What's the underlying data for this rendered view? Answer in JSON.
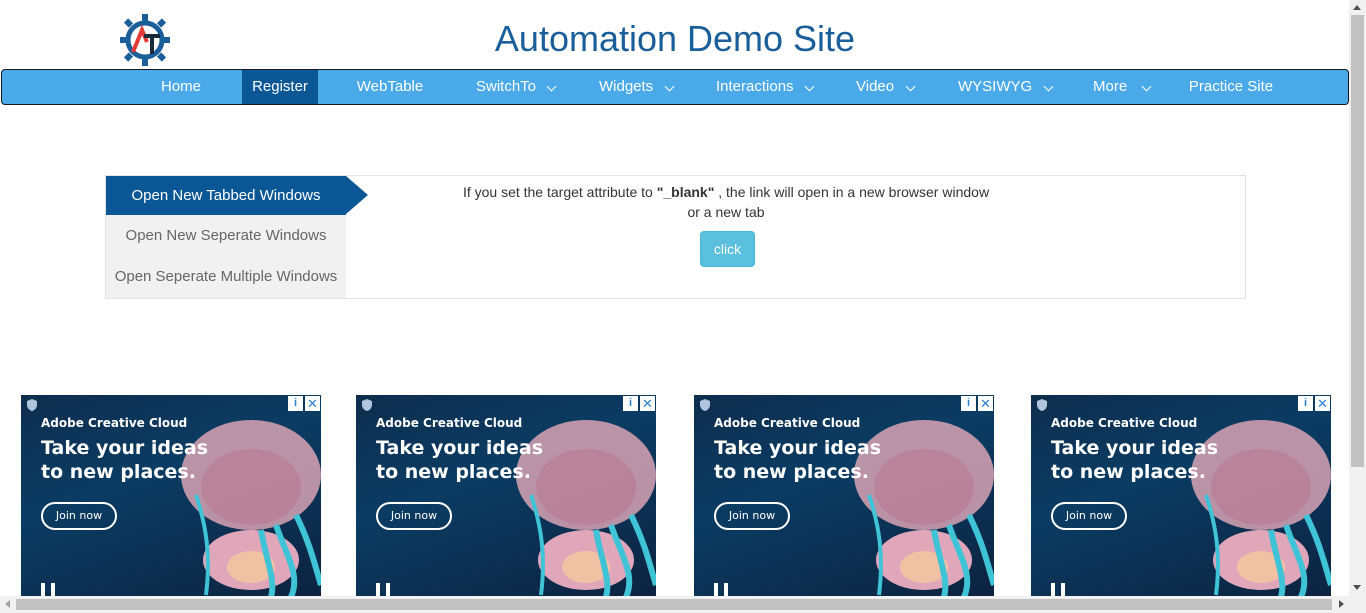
{
  "header": {
    "title": "Automation Demo Site",
    "logo_icon": "gear-logo-icon",
    "colors": {
      "title": "#1a5e9a",
      "navbar": "#4aa9e9",
      "nav_active": "#0b5796"
    }
  },
  "nav": {
    "items": [
      {
        "label": "Home",
        "dropdown": false,
        "active": false
      },
      {
        "label": "Register",
        "dropdown": false,
        "active": true
      },
      {
        "label": "WebTable",
        "dropdown": false,
        "active": false
      },
      {
        "label": "SwitchTo",
        "dropdown": true,
        "active": false
      },
      {
        "label": "Widgets",
        "dropdown": true,
        "active": false
      },
      {
        "label": "Interactions",
        "dropdown": true,
        "active": false
      },
      {
        "label": "Video",
        "dropdown": true,
        "active": false
      },
      {
        "label": "WYSIWYG",
        "dropdown": true,
        "active": false
      },
      {
        "label": "More",
        "dropdown": true,
        "active": false
      },
      {
        "label": "Practice Site",
        "dropdown": false,
        "active": false
      }
    ]
  },
  "windows": {
    "tabs": [
      {
        "label": "Open New Tabbed Windows",
        "active": true
      },
      {
        "label": "Open New Seperate Windows",
        "active": false
      },
      {
        "label": "Open Seperate Multiple Windows",
        "active": false
      }
    ],
    "description_prefix": "If you set the target attribute to ",
    "description_code": "\"_blank\"",
    "description_suffix_line1": " , the link will open in a new browser window",
    "description_line2": "or a new tab",
    "button_label": "click",
    "button_color": "#5bc0de"
  },
  "ads": [
    {
      "brand": "Adobe Creative Cloud",
      "headline_line1": "Take your ideas",
      "headline_line2": "to new places.",
      "cta": "Join now"
    },
    {
      "brand": "Adobe Creative Cloud",
      "headline_line1": "Take your ideas",
      "headline_line2": "to new places.",
      "cta": "Join now"
    },
    {
      "brand": "Adobe Creative Cloud",
      "headline_line1": "Take your ideas",
      "headline_line2": "to new places.",
      "cta": "Join now"
    },
    {
      "brand": "Adobe Creative Cloud",
      "headline_line1": "Take your ideas",
      "headline_line2": "to new places.",
      "cta": "Join now"
    }
  ],
  "ad_icons": {
    "info": "info-icon",
    "close": "close-icon",
    "adchoices": "shield-icon"
  }
}
